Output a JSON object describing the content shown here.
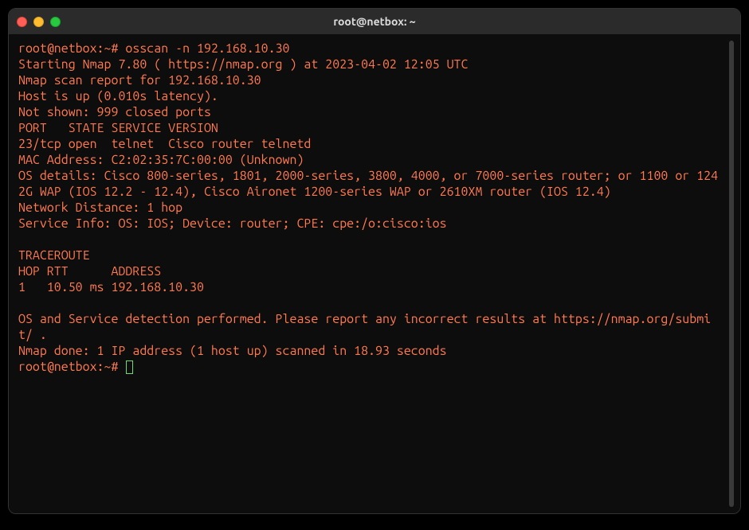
{
  "window": {
    "title": "root@netbox: ~"
  },
  "session": {
    "prompt1": "root@netbox:~#",
    "command1": "osscan -n 192.168.10.30",
    "output_lines": [
      "Starting Nmap 7.80 ( https://nmap.org ) at 2023-04-02 12:05 UTC",
      "Nmap scan report for 192.168.10.30",
      "Host is up (0.010s latency).",
      "Not shown: 999 closed ports",
      "PORT   STATE SERVICE VERSION",
      "23/tcp open  telnet  Cisco router telnetd",
      "MAC Address: C2:02:35:7C:00:00 (Unknown)",
      "OS details: Cisco 800-series, 1801, 2000-series, 3800, 4000, or 7000-series router; or 1100 or 1242G WAP (IOS 12.2 - 12.4), Cisco Aironet 1200-series WAP or 2610XM router (IOS 12.4)",
      "Network Distance: 1 hop",
      "Service Info: OS: IOS; Device: router; CPE: cpe:/o:cisco:ios",
      "",
      "TRACEROUTE",
      "HOP RTT      ADDRESS",
      "1   10.50 ms 192.168.10.30",
      "",
      "OS and Service detection performed. Please report any incorrect results at https://nmap.org/submit/ .",
      "Nmap done: 1 IP address (1 host up) scanned in 18.93 seconds"
    ],
    "prompt2": "root@netbox:~#"
  }
}
